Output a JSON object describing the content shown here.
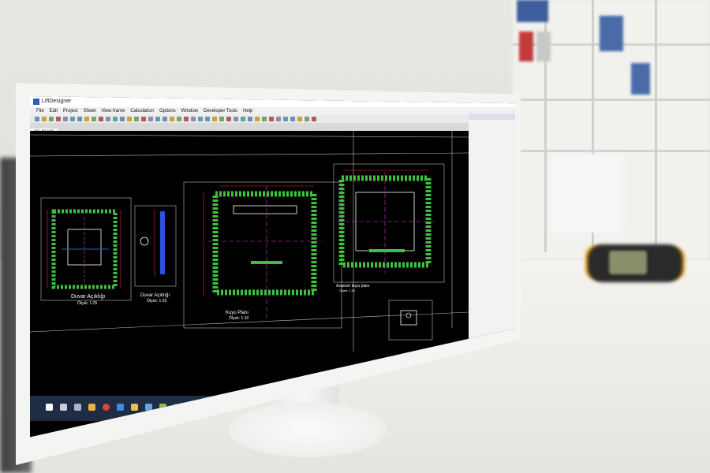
{
  "app": {
    "title": "LiftDesigner",
    "document_tab": "20-43.bl3"
  },
  "menu": [
    "File",
    "Edit",
    "Project",
    "Sheet",
    "View frame",
    "Calculation",
    "Options",
    "Window",
    "Developer Tools",
    "Help"
  ],
  "drawing_labels": {
    "view1_title": "Duvar Açıklığı",
    "view1_scale": "Ölçek: 1:25",
    "view2_title": "Duvar Açıklığı",
    "view2_scale": "Ölçek: 1:25",
    "view3_title": "Kuyu Planı",
    "view3_scale": "Ölçek: 1:10",
    "view4_title": "Asansör kuyu planı",
    "view4_scale": "Ölçek: 1:10"
  },
  "colors": {
    "wall_hatch": "#3fbf3f",
    "dim_red": "#e23030",
    "dim_magenta": "#d040d0",
    "blue_hatch": "#3050e0",
    "device_accent": "#e8a51a"
  },
  "taskbar_icons": [
    "start-icon",
    "search-icon",
    "task-view-icon",
    "folder-icon",
    "chrome-icon",
    "edge-icon",
    "explorer-icon",
    "store-icon",
    "app-icon",
    "liftdesigner-icon"
  ]
}
